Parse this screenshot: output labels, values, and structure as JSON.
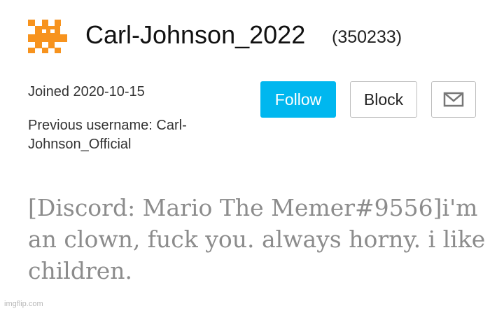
{
  "profile": {
    "avatar_icon": "orange-pixel-avatar-icon",
    "avatar_color": "#f7931e",
    "username": "Carl-Johnson_2022",
    "points": "(350233)",
    "joined": "Joined 2020-10-15",
    "previous_username": "Previous username: Carl-Johnson_Official"
  },
  "actions": {
    "follow_label": "Follow",
    "block_label": "Block",
    "message_icon": "envelope-icon",
    "accent_color": "#00b7ef"
  },
  "bio": "[Discord: Mario The Memer#9556]i'm an clown, fuck you. always horny. i like children.",
  "watermark": "imgflip.com"
}
